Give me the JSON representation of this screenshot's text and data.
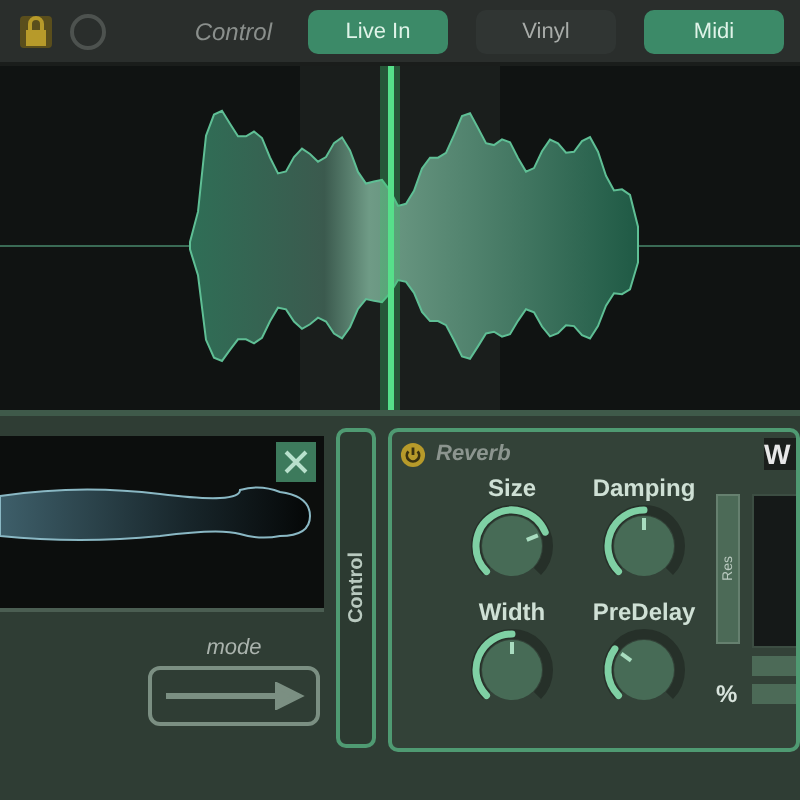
{
  "toolbar": {
    "label": "Control",
    "buttons": [
      {
        "label": "Live In",
        "selected": true
      },
      {
        "label": "Vinyl",
        "selected": false
      },
      {
        "label": "Midi",
        "selected": true
      }
    ]
  },
  "sampler": {
    "mode_label": "mode"
  },
  "control_tab": {
    "label": "Control"
  },
  "reverb": {
    "title": "Reverb",
    "enabled": true,
    "knobs": [
      {
        "label": "Size"
      },
      {
        "label": "Damping"
      },
      {
        "label": "Width"
      },
      {
        "label": "PreDelay"
      }
    ],
    "side_label": "Res",
    "cut_label": "W",
    "percent": "%"
  }
}
